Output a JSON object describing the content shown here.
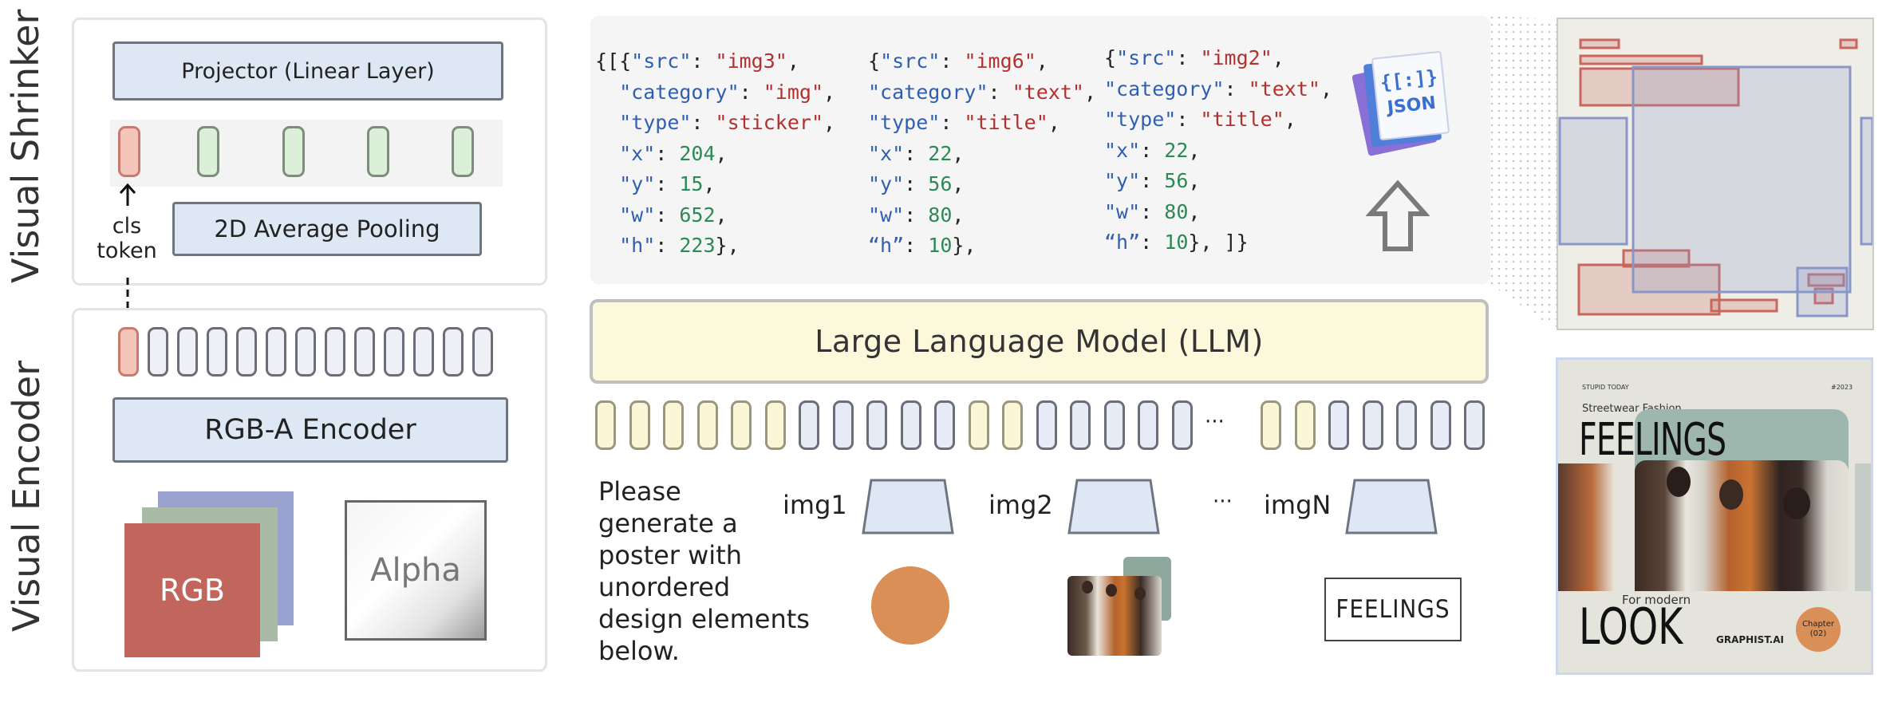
{
  "labels": {
    "visual_shrinker": "Visual Shrinker",
    "visual_encoder": "Visual Encoder"
  },
  "shrinker": {
    "projector": "Projector (Linear Layer)",
    "pooling": "2D Average Pooling",
    "cls_line1": "cls",
    "cls_line2": "token"
  },
  "encoder": {
    "title": "RGB-A Encoder",
    "rgb": "RGB",
    "alpha": "Alpha"
  },
  "llm": {
    "title": "Large Language Model (LLM)",
    "ellipsis": "···"
  },
  "json_output": {
    "col1": [
      {
        "pre": "{[{",
        "key": "\"src\"",
        "sep": ": ",
        "val": "\"img3\"",
        "vtype": "s",
        "post": ","
      },
      {
        "pre": "  ",
        "key": "\"category\"",
        "sep": ": ",
        "val": "\"img\"",
        "vtype": "s",
        "post": ","
      },
      {
        "pre": "  ",
        "key": "\"type\"",
        "sep": ": ",
        "val": "\"sticker\"",
        "vtype": "s",
        "post": ","
      },
      {
        "pre": "  ",
        "key": "\"x\"",
        "sep": ": ",
        "val": "204",
        "vtype": "n",
        "post": ","
      },
      {
        "pre": "  ",
        "key": "\"y\"",
        "sep": ": ",
        "val": "15",
        "vtype": "n",
        "post": ","
      },
      {
        "pre": "  ",
        "key": "\"w\"",
        "sep": ": ",
        "val": "652",
        "vtype": "n",
        "post": ","
      },
      {
        "pre": "  ",
        "key": "\"h\"",
        "sep": ": ",
        "val": "223",
        "vtype": "n",
        "post": "},"
      }
    ],
    "col2": [
      {
        "pre": "{",
        "key": "\"src\"",
        "sep": ": ",
        "val": "\"img6\"",
        "vtype": "s",
        "post": ","
      },
      {
        "pre": "",
        "key": "\"category\"",
        "sep": ": ",
        "val": "\"text\"",
        "vtype": "s",
        "post": ","
      },
      {
        "pre": "",
        "key": "\"type\"",
        "sep": ": ",
        "val": "\"title\"",
        "vtype": "s",
        "post": ","
      },
      {
        "pre": "",
        "key": "\"x\"",
        "sep": ": ",
        "val": "22",
        "vtype": "n",
        "post": ","
      },
      {
        "pre": "",
        "key": "\"y\"",
        "sep": ": ",
        "val": "56",
        "vtype": "n",
        "post": ","
      },
      {
        "pre": "",
        "key": "\"w\"",
        "sep": ": ",
        "val": "80",
        "vtype": "n",
        "post": ","
      },
      {
        "pre": "",
        "key": "“h”",
        "sep": ": ",
        "val": "10",
        "vtype": "n",
        "post": "},"
      }
    ],
    "col3": [
      {
        "pre": "{",
        "key": "\"src\"",
        "sep": ": ",
        "val": "\"img2\"",
        "vtype": "s",
        "post": ","
      },
      {
        "pre": "",
        "key": "\"category\"",
        "sep": ": ",
        "val": "\"text\"",
        "vtype": "s",
        "post": ","
      },
      {
        "pre": "",
        "key": "\"type\"",
        "sep": ": ",
        "val": "\"title\"",
        "vtype": "s",
        "post": ","
      },
      {
        "pre": "",
        "key": "\"x\"",
        "sep": ": ",
        "val": "22",
        "vtype": "n",
        "post": ","
      },
      {
        "pre": "",
        "key": "\"y\"",
        "sep": ": ",
        "val": "56",
        "vtype": "n",
        "post": ","
      },
      {
        "pre": "",
        "key": "\"w\"",
        "sep": ": ",
        "val": "80",
        "vtype": "n",
        "post": ","
      },
      {
        "pre": "",
        "key": "“h”",
        "sep": ": ",
        "val": "10",
        "vtype": "n",
        "post": "}, ]}"
      }
    ],
    "json_icon_text": "JSON",
    "json_icon_glyph": "{[:]}"
  },
  "prompt": {
    "text_lines": [
      "Please",
      "generate a",
      "poster with",
      "unordered",
      "design elements",
      "below."
    ],
    "img1": "img1",
    "img2": "img2",
    "ellipsis": "···",
    "imgN": "imgN",
    "feelings_element": "FEELINGS"
  },
  "poster": {
    "small_top_left": "STUPID TODAY",
    "small_top_right": "#2023",
    "subtitle": "Streetwear Fashion",
    "title": "FEELINGS",
    "for_modern": "For modern",
    "look": "LOOK",
    "brand": "GRAPHIST.AI",
    "chapter_line1": "Chapter",
    "chapter_line2": "(02)"
  },
  "colors": {
    "accent_red": "#c9665e",
    "accent_blue": "#8a96c8",
    "token_yellow": "#fbf6d6",
    "token_blue": "#e6ebf5",
    "llm_box": "#fbf8dc",
    "orange_circle": "#d98f55"
  }
}
